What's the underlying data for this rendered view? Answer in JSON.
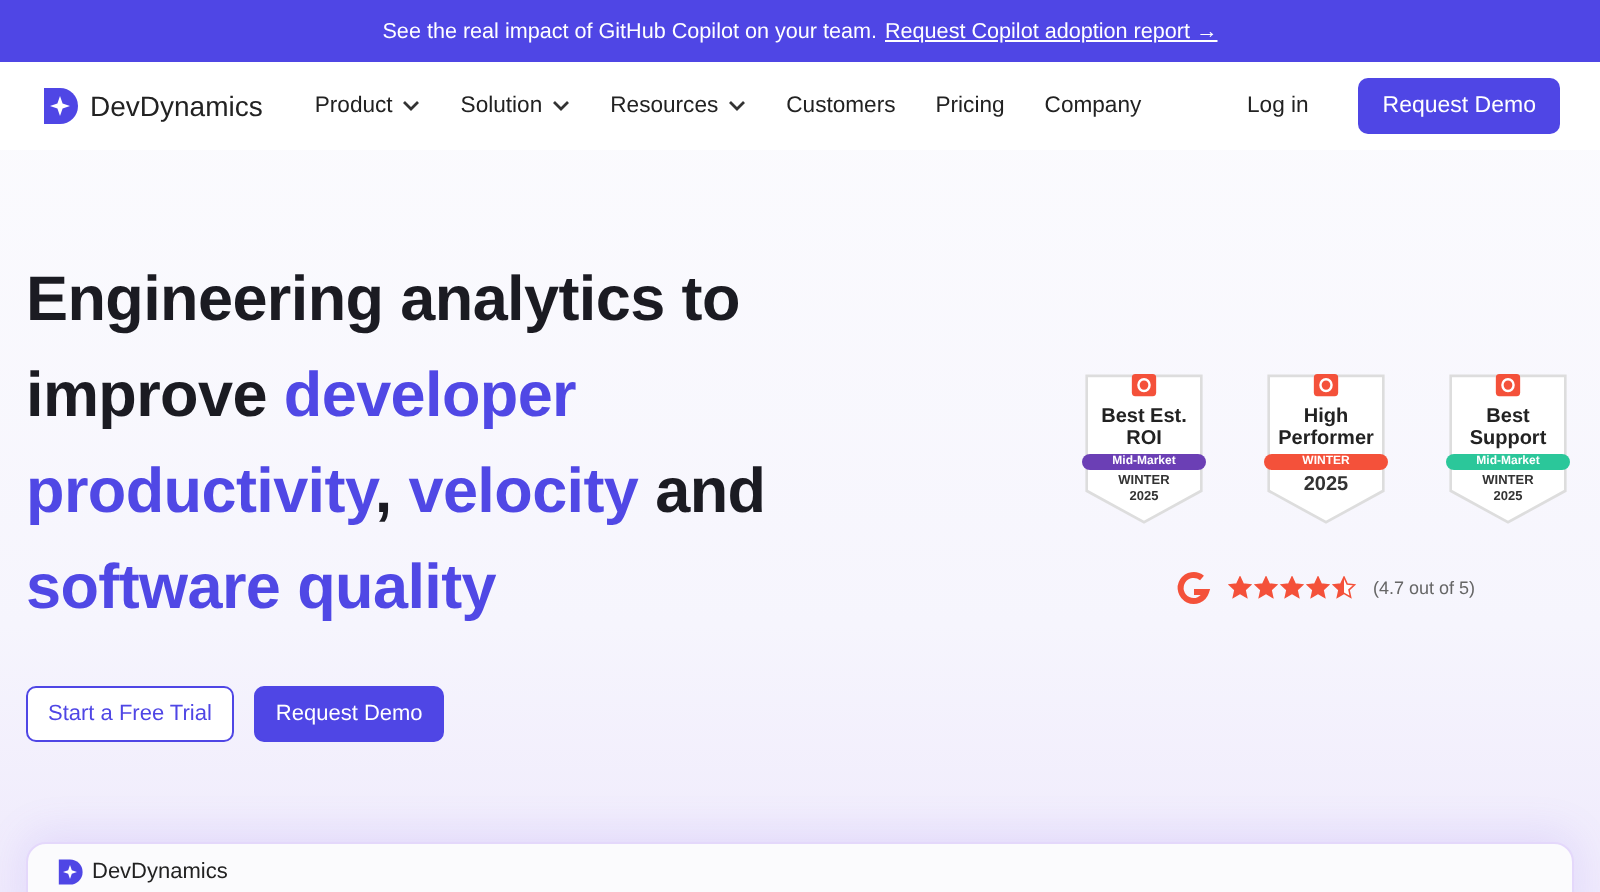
{
  "banner": {
    "text": "See the real impact of GitHub Copilot on your team.",
    "link": "Request Copilot adoption report →"
  },
  "nav": {
    "brand": "DevDynamics",
    "items": [
      {
        "label": "Product",
        "dropdown": true
      },
      {
        "label": "Solution",
        "dropdown": true
      },
      {
        "label": "Resources",
        "dropdown": true
      },
      {
        "label": "Customers",
        "dropdown": false
      },
      {
        "label": "Pricing",
        "dropdown": false
      },
      {
        "label": "Company",
        "dropdown": false
      }
    ],
    "login": "Log in",
    "cta": "Request Demo"
  },
  "hero": {
    "headline": [
      [
        {
          "text": "Engineering analytics to",
          "accent": false
        }
      ],
      [
        {
          "text": "improve ",
          "accent": false
        },
        {
          "text": "developer",
          "accent": true
        }
      ],
      [
        {
          "text": "productivity",
          "accent": true
        },
        {
          "text": ", ",
          "accent": false
        },
        {
          "text": "velocity",
          "accent": true
        },
        {
          "text": " and",
          "accent": false
        }
      ],
      [
        {
          "text": "software quality",
          "accent": true
        }
      ]
    ],
    "buttons": [
      {
        "label": "Start a Free Trial",
        "kind": "outline"
      },
      {
        "label": "Request Demo",
        "kind": "filled"
      }
    ]
  },
  "badges": [
    {
      "title": "Best Est. ROI",
      "ribbon": "Mid-Market",
      "color": "#6b3fb5",
      "season": "WINTER 2025"
    },
    {
      "title": "High Performer",
      "ribbon": "WINTER",
      "color": "#f4513a",
      "season": "2025"
    },
    {
      "title": "Best Support",
      "ribbon": "Mid-Market",
      "color": "#2bc79a",
      "season": "WINTER 2025"
    }
  ],
  "rating": {
    "stars": 4.5,
    "text": "(4.7 out of 5)"
  },
  "preview": {
    "brand": "DevDynamics"
  }
}
